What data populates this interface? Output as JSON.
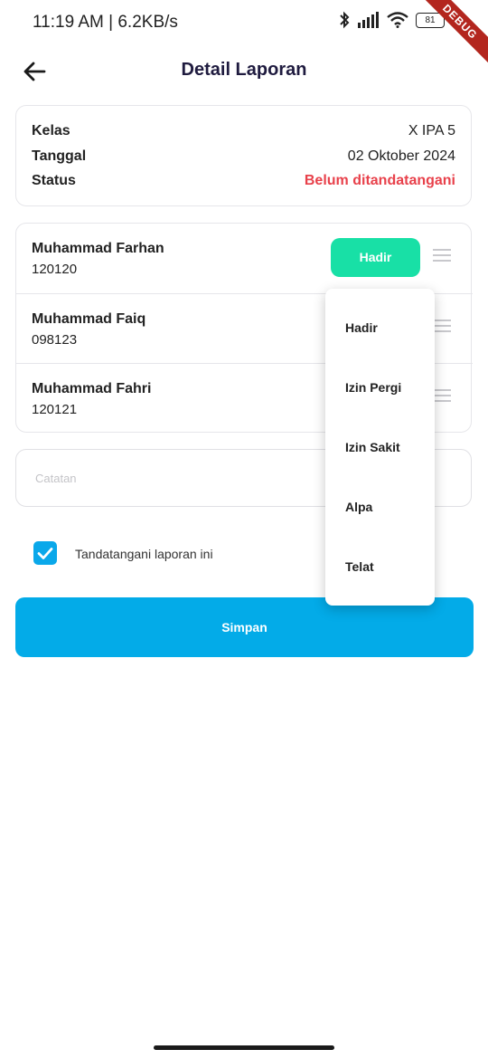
{
  "status_bar": {
    "time_speed": "11:19 AM | 6.2KB/s",
    "battery": "81",
    "debug_label": "DEBUG"
  },
  "header": {
    "title": "Detail Laporan",
    "back_icon": "arrow-left-icon"
  },
  "info": {
    "kelas_label": "Kelas",
    "kelas_value": "X IPA 5",
    "tanggal_label": "Tanggal",
    "tanggal_value": "02 Oktober 2024",
    "status_label": "Status",
    "status_value": "Belum ditandatangani",
    "status_color": "#e8414b"
  },
  "students": [
    {
      "name": "Muhammad Farhan",
      "id": "120120",
      "status": "Hadir"
    },
    {
      "name": "Muhammad Faiq",
      "id": "098123",
      "status": ""
    },
    {
      "name": "Muhammad Fahri",
      "id": "120121",
      "status": ""
    }
  ],
  "dropdown": {
    "options": [
      "Hadir",
      "Izin Pergi",
      "Izin Sakit",
      "Alpa",
      "Telat"
    ]
  },
  "note": {
    "placeholder": "Catatan",
    "value": ""
  },
  "sign": {
    "checked": true,
    "label": "Tandatangani laporan ini"
  },
  "actions": {
    "save_label": "Simpan",
    "primary_color": "#03abe8",
    "chip_color": "#18e0a6"
  }
}
